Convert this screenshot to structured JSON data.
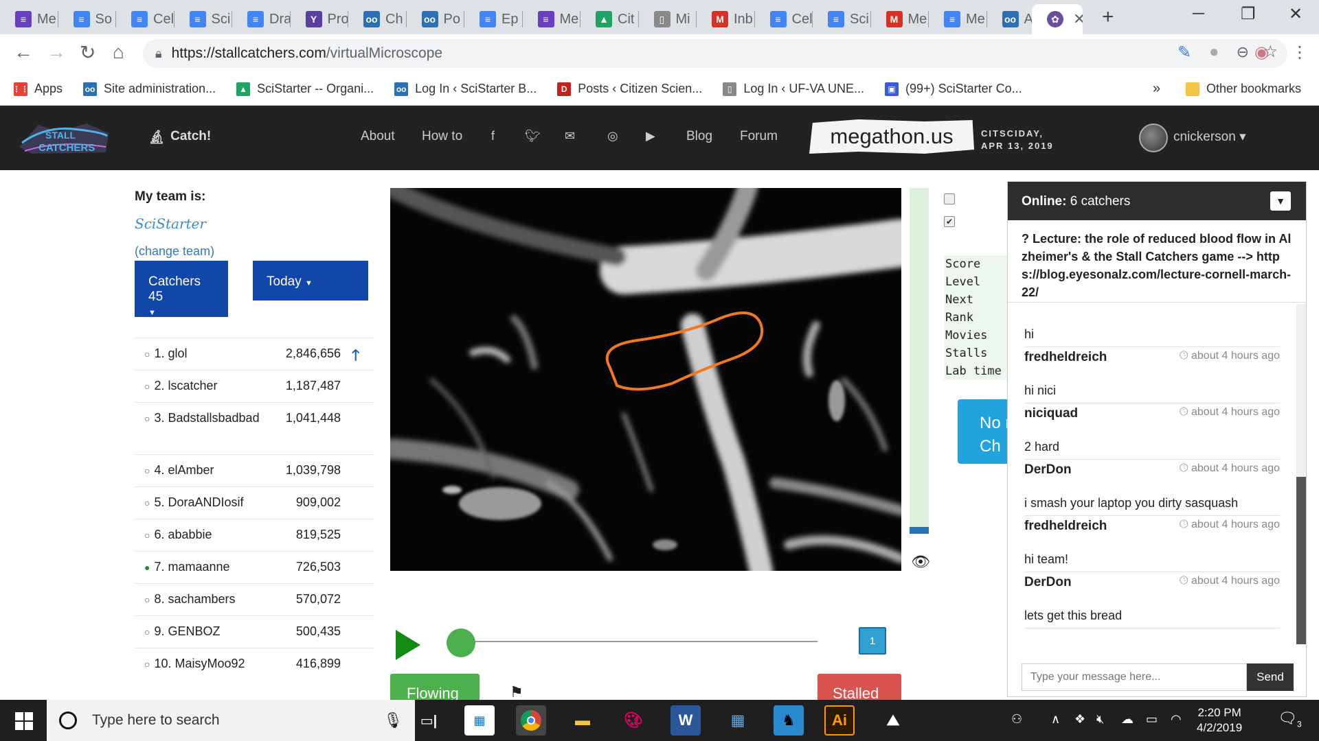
{
  "browser": {
    "tabs": [
      {
        "label": "Me",
        "color": "#6a3fbf",
        "glyph": "≡"
      },
      {
        "label": "So",
        "color": "#4285f4",
        "glyph": "≡"
      },
      {
        "label": "Cel",
        "color": "#4285f4",
        "glyph": "≡"
      },
      {
        "label": "Sci",
        "color": "#4285f4",
        "glyph": "≡"
      },
      {
        "label": "Dra",
        "color": "#4285f4",
        "glyph": "≡"
      },
      {
        "label": "Pro",
        "color": "#5a3fa0",
        "glyph": "Y"
      },
      {
        "label": "Ch",
        "color": "#2b6fb5",
        "glyph": "oo"
      },
      {
        "label": "Po",
        "color": "#2b6fb5",
        "glyph": "oo"
      },
      {
        "label": "Ep",
        "color": "#4285f4",
        "glyph": "≡"
      },
      {
        "label": "Me",
        "color": "#6a3fbf",
        "glyph": "≡"
      },
      {
        "label": "Cit",
        "color": "#1fa463",
        "glyph": "▲"
      },
      {
        "label": "Mi",
        "color": "#888888",
        "glyph": "▯"
      },
      {
        "label": "Inb",
        "color": "#d93025",
        "glyph": "M"
      },
      {
        "label": "Cel",
        "color": "#4285f4",
        "glyph": "≡"
      },
      {
        "label": "Sci",
        "color": "#4285f4",
        "glyph": "≡"
      },
      {
        "label": "Me",
        "color": "#d93025",
        "glyph": "M"
      },
      {
        "label": "Me",
        "color": "#4285f4",
        "glyph": "≡"
      },
      {
        "label": "Ad",
        "color": "#2b6fb5",
        "glyph": "oo"
      }
    ],
    "url_host": "https://stallcatchers.com",
    "url_path": "/virtualMicroscope",
    "bookmarks": [
      {
        "label": "Apps",
        "color": "#e94235",
        "glyph": "⋮⋮"
      },
      {
        "label": "Site administration...",
        "color": "#2b6fb5",
        "glyph": "oo"
      },
      {
        "label": "SciStarter -- Organi...",
        "color": "#1fa463",
        "glyph": "▲"
      },
      {
        "label": "Log In ‹ SciStarter B...",
        "color": "#2b6fb5",
        "glyph": "oo"
      },
      {
        "label": "Posts ‹ Citizen Scien...",
        "color": "#c5221f",
        "glyph": "D"
      },
      {
        "label": "Log In ‹ UF-VA UNE...",
        "color": "#888888",
        "glyph": "▯"
      },
      {
        "label": "(99+) SciStarter Co...",
        "color": "#3b5bdb",
        "glyph": "▣"
      }
    ],
    "bookmarks_overflow": "»",
    "other_bookmarks": "Other bookmarks"
  },
  "site": {
    "logo_text": "STALL CATCHERS",
    "catch_label": "Catch!",
    "nav": [
      "About",
      "How to",
      "Blog",
      "Forum"
    ],
    "social_icons": [
      "facebook-icon",
      "twitter-icon",
      "mail-icon",
      "instagram-icon",
      "youtube-icon"
    ],
    "banner": "megathon.us",
    "banner_line1": "CITSCIDAY,",
    "banner_line2": "APR 13, 2019",
    "username": "cnickerson"
  },
  "leaderboard": {
    "title": "My team is:",
    "team": "SciStarter",
    "change_team": "(change team)",
    "catchers_label": "Catchers",
    "catchers_count": "45",
    "period": "Today",
    "rows": [
      {
        "rank": "1. glol",
        "score": "2,846,656",
        "online": false,
        "trend": "up"
      },
      {
        "rank": "2. lscatcher",
        "score": "1,187,487",
        "online": false
      },
      {
        "rank": "3. Badstallsbadbad",
        "score": "1,041,448",
        "online": false
      },
      {
        "rank": "4. elAmber",
        "score": "1,039,798",
        "online": false
      },
      {
        "rank": "5. DoraANDIosif",
        "score": "909,002",
        "online": false
      },
      {
        "rank": "6. ababbie",
        "score": "819,525",
        "online": false
      },
      {
        "rank": "7. mamaanne",
        "score": "726,503",
        "online": true
      },
      {
        "rank": "8. sachambers",
        "score": "570,072",
        "online": false
      },
      {
        "rank": "9. GENBOZ",
        "score": "500,435",
        "online": false
      },
      {
        "rank": "10. MaisyMoo92",
        "score": "416,899",
        "online": false
      }
    ]
  },
  "microscope": {
    "stats_labels": [
      "Score",
      "Level",
      "Next",
      "Rank",
      "Movies",
      "Stalls",
      "Lab time"
    ],
    "side_button": "No r Ch",
    "side_button_line1": "No r",
    "side_button_line2": "Ch",
    "frame_number": "1",
    "flowing_label": "Flowing",
    "stalled_label": "Stalled",
    "checkbox_1_checked": false,
    "checkbox_2_checked": true
  },
  "chat": {
    "online_label": "Online:",
    "online_count": "6 catchers",
    "announcement": "? Lecture: the role of reduced blood flow in Alzheimer's & the Stall Catchers game --> https://blog.eyesonalz.com/lecture-cornell-march-22/",
    "messages": [
      {
        "text": "hi",
        "author": "fredheldreich",
        "time": "about 4 hours ago"
      },
      {
        "text": "hi nici",
        "author": "niciquad",
        "time": "about 4 hours ago"
      },
      {
        "text": "2 hard",
        "author": "DerDon",
        "time": "about 4 hours ago"
      },
      {
        "text": "i smash your laptop you dirty sasquash",
        "author": "fredheldreich",
        "time": "about 4 hours ago"
      },
      {
        "text": "hi team!",
        "author": "DerDon",
        "time": "about 4 hours ago"
      },
      {
        "text": "lets get this bread",
        "author": "",
        "time": ""
      }
    ],
    "input_placeholder": "Type your message here...",
    "send_label": "Send"
  },
  "taskbar": {
    "search_placeholder": "Type here to search",
    "time": "2:20 PM",
    "date": "4/2/2019",
    "notification_count": "3"
  }
}
